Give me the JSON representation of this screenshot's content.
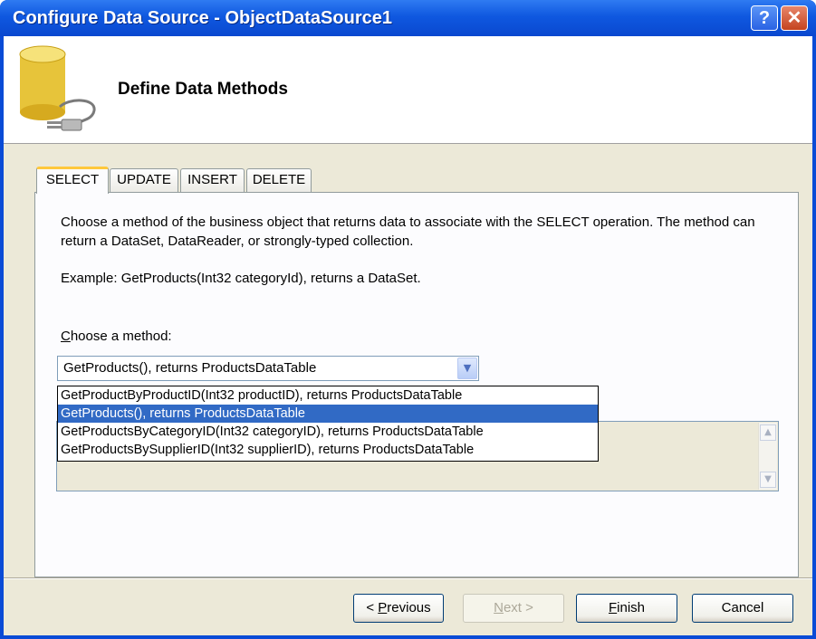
{
  "window": {
    "title": "Configure Data Source - ObjectDataSource1",
    "help_glyph": "?",
    "close_glyph": "✕"
  },
  "header": {
    "title": "Define Data Methods",
    "icon": "database-plug-icon"
  },
  "tabs": [
    {
      "label": "SELECT",
      "active": true
    },
    {
      "label": "UPDATE",
      "active": false
    },
    {
      "label": "INSERT",
      "active": false
    },
    {
      "label": "DELETE",
      "active": false
    }
  ],
  "panel": {
    "description": "Choose a method of the business object that returns data to associate with the SELECT operation. The method can return a DataSet, DataReader, or strongly-typed collection.",
    "example": "Example: GetProducts(Int32 categoryId), returns a DataSet.",
    "choose_label_key": "C",
    "choose_label_rest": "hoose a method:"
  },
  "method_combo": {
    "value": "GetProducts(), returns ProductsDataTable",
    "options": [
      "GetProductByProductID(Int32 productID), returns ProductsDataTable",
      "GetProducts(), returns ProductsDataTable",
      "GetProductsByCategoryID(Int32 categoryID), returns ProductsDataTable",
      "GetProductsBySupplierID(Int32 supplierID), returns ProductsDataTable"
    ],
    "selected_index": 1
  },
  "buttons": {
    "previous_prefix": "< ",
    "previous_key": "P",
    "previous_rest": "revious",
    "next_key": "N",
    "next_rest": "ext >",
    "finish_key": "F",
    "finish_rest": "inish",
    "cancel": "Cancel"
  },
  "colors": {
    "titlebar": "#0a48cf",
    "selection": "#316ac5",
    "tab_highlight": "#ffc83c",
    "dialog_bg": "#ece9d8"
  }
}
